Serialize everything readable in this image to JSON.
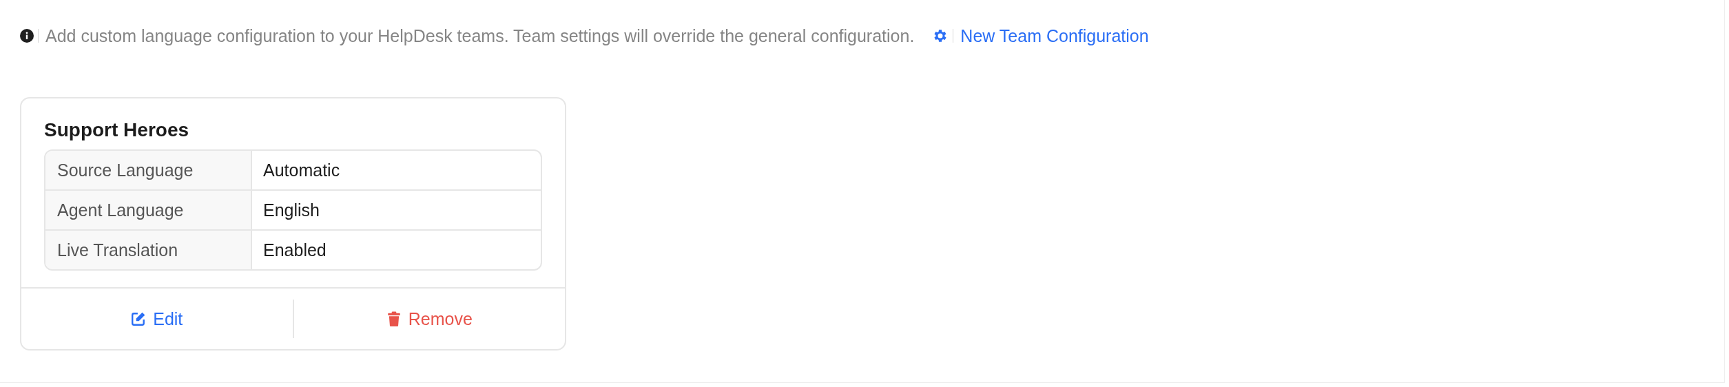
{
  "notice": {
    "text": "Add custom language configuration to your HelpDesk teams. Team settings will override the general configuration.",
    "link": "New Team Configuration"
  },
  "teams": [
    {
      "name": "Support Heroes",
      "rows": [
        {
          "label": "Source Language",
          "value": "Automatic"
        },
        {
          "label": "Agent Language",
          "value": "English"
        },
        {
          "label": "Live Translation",
          "value": "Enabled"
        }
      ],
      "actions": [
        {
          "kind": "edit",
          "label": "Edit"
        },
        {
          "kind": "remove",
          "label": "Remove"
        }
      ]
    }
  ]
}
